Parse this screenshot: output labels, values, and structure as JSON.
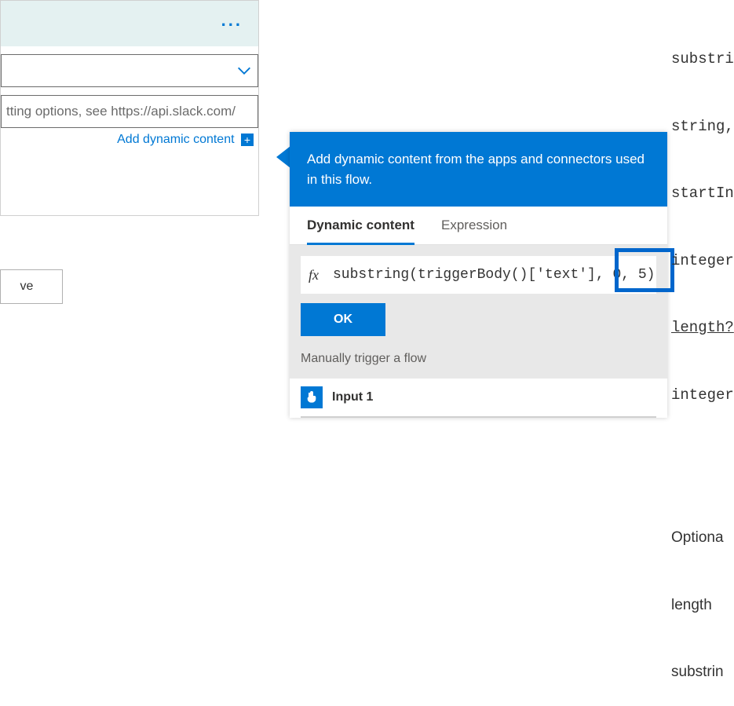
{
  "left_card": {
    "more_label": "...",
    "dropdown_value": "",
    "text_placeholder": "tting options, see https://api.slack.com/",
    "add_dynamic_label": "Add dynamic content",
    "plus_label": "+"
  },
  "save_button": {
    "label": "ve"
  },
  "panel": {
    "header_text": "Add dynamic content from the apps and connectors used in this flow.",
    "tabs": {
      "dynamic": "Dynamic content",
      "expression": "Expression",
      "active": "dynamic"
    },
    "expression": {
      "fx_label": "fx",
      "code": "substring(triggerBody()['text'], 0, 5)",
      "highlight_fragment": ", 0, 5"
    },
    "ok_label": "OK",
    "section_title": "Manually trigger a flow",
    "items": [
      {
        "icon": "touch-icon",
        "label": "Input 1"
      }
    ]
  },
  "doc_sidebar": {
    "lines": [
      "substri",
      "string,",
      "startIn",
      "integer",
      "length?",
      "integer"
    ],
    "desc": [
      "Optiona",
      "length",
      "substrin"
    ]
  },
  "chart_data": null
}
